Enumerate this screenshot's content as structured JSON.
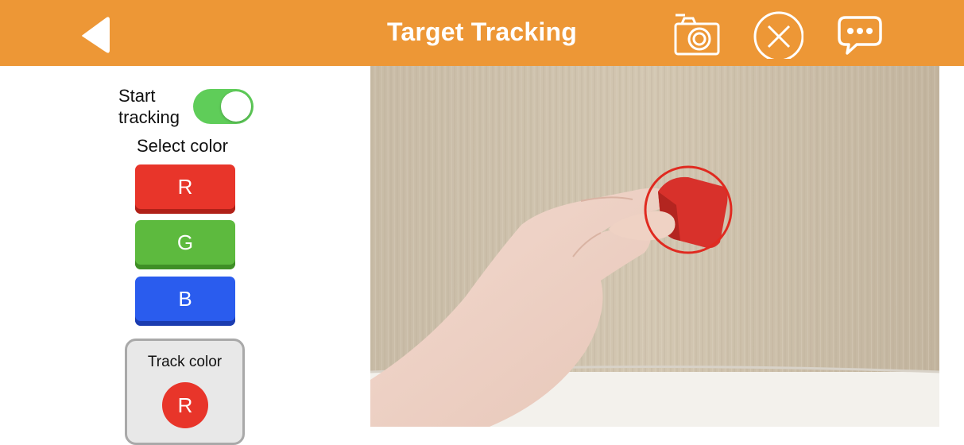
{
  "header": {
    "title": "Target Tracking",
    "icons": {
      "back": "back-arrow-icon",
      "camera": "camera-icon",
      "close": "close-circle-icon",
      "chat": "chat-bubble-icon"
    },
    "bg_color": "#ED9736"
  },
  "controls": {
    "start_tracking_label": "Start tracking",
    "toggle_on": true,
    "select_color_label": "Select color",
    "color_buttons": [
      {
        "label": "R",
        "color": "#E8352A"
      },
      {
        "label": "G",
        "color": "#5DBA3E"
      },
      {
        "label": "B",
        "color": "#2A5CEE"
      }
    ],
    "track_color_label": "Track color",
    "track_color_value": "R",
    "track_color_hex": "#E8352A"
  }
}
